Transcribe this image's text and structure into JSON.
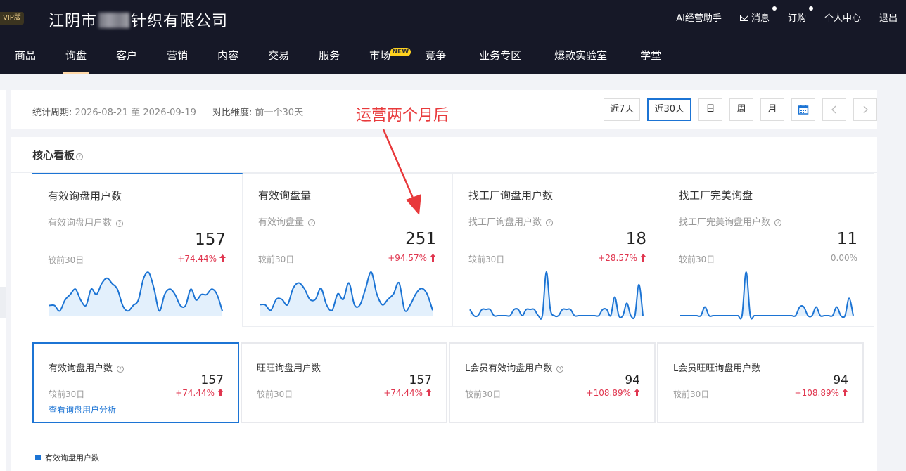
{
  "header": {
    "vip_badge": "VIP版",
    "company_prefix": "江阴市",
    "company_suffix": "针织有限公司",
    "links": [
      {
        "label": "AI经营助手",
        "dot": false
      },
      {
        "label": "消息",
        "dot": true
      },
      {
        "label": "订购",
        "dot": true
      },
      {
        "label": "个人中心",
        "dot": false
      },
      {
        "label": "退出",
        "dot": false
      }
    ]
  },
  "nav": {
    "items": [
      "商品",
      "询盘",
      "客户",
      "营销",
      "内容",
      "交易",
      "服务",
      "市场",
      "竞争",
      "业务专区",
      "爆款实验室",
      "学堂"
    ],
    "active_index": 1,
    "new_badge": "NEW"
  },
  "filter": {
    "period_label": "统计周期:",
    "period_start": "2026-08-21",
    "period_sep": "至",
    "period_end": "2026-09-19",
    "compare_label": "对比维度:",
    "compare_value": "前一个30天",
    "buttons": [
      "近7天",
      "近30天",
      "日",
      "周",
      "月"
    ],
    "active_button": "近30天"
  },
  "annotation": "运营两个月后",
  "board": {
    "title": "核心看板",
    "kpis": [
      {
        "title": "有效询盘用户数",
        "sub": "有效询盘用户数",
        "value": "157",
        "cmp_label": "较前30日",
        "cmp": "+74.44%",
        "up": true
      },
      {
        "title": "有效询盘量",
        "sub": "有效询盘量",
        "value": "251",
        "cmp_label": "较前30日",
        "cmp": "+94.57%",
        "up": true
      },
      {
        "title": "找工厂询盘用户数",
        "sub": "找工厂询盘用户数",
        "value": "18",
        "cmp_label": "较前30日",
        "cmp": "+28.57%",
        "up": true
      },
      {
        "title": "找工厂完美询盘",
        "sub": "找工厂完美询盘用户数",
        "value": "11",
        "cmp_label": "较前30日",
        "cmp": "0.00%",
        "up": false
      }
    ],
    "small_cards": [
      {
        "title": "有效询盘用户数",
        "value": "157",
        "cmp_label": "较前30日",
        "cmp": "+74.44%",
        "link": "查看询盘用户分析",
        "help": true
      },
      {
        "title": "旺旺询盘用户数",
        "value": "157",
        "cmp_label": "较前30日",
        "cmp": "+74.44%",
        "help": false
      },
      {
        "title": "L会员有效询盘用户数",
        "value": "94",
        "cmp_label": "较前30日",
        "cmp": "+108.89%",
        "help": true
      },
      {
        "title": "L会员旺旺询盘用户数",
        "value": "94",
        "cmp_label": "较前30日",
        "cmp": "+108.89%",
        "help": false
      }
    ],
    "legend": "有效询盘用户数"
  },
  "colors": {
    "accent": "#1c74d4",
    "up": "#e0364f",
    "header_bg": "#161827",
    "annotation": "#e8393b"
  },
  "sparklines": [
    [
      2,
      2,
      1,
      3,
      4,
      5,
      3,
      2,
      5,
      4,
      6,
      7,
      6,
      5,
      2,
      1,
      2,
      3,
      7,
      8,
      5,
      1,
      4,
      5,
      4,
      2,
      2,
      5,
      3,
      4,
      4,
      5,
      4,
      1
    ],
    [
      2,
      2,
      1,
      3,
      3,
      2,
      5,
      6,
      5,
      3,
      3,
      5,
      2,
      1,
      4,
      3,
      6,
      2,
      2,
      5,
      8,
      4,
      2,
      3,
      4,
      6,
      1,
      2,
      4,
      5,
      4,
      1
    ],
    [
      1,
      0,
      0,
      1,
      1,
      1,
      0,
      0,
      0,
      0,
      0,
      1,
      1,
      0,
      1,
      1,
      1,
      0,
      0,
      7,
      1,
      0,
      0,
      1,
      1,
      1,
      0,
      0,
      0,
      0,
      0,
      0,
      0,
      1,
      1,
      0,
      3,
      0,
      0,
      2,
      0,
      0,
      5,
      0
    ],
    [
      0,
      0,
      0,
      0,
      0,
      0,
      1,
      0,
      0,
      0,
      0,
      0,
      0,
      0,
      0,
      0,
      5,
      0,
      0,
      0,
      0,
      0,
      0,
      0,
      0,
      0,
      0,
      0,
      0,
      1,
      1,
      0,
      0,
      1,
      0,
      0,
      0,
      0,
      1,
      0,
      0,
      2,
      0
    ]
  ]
}
